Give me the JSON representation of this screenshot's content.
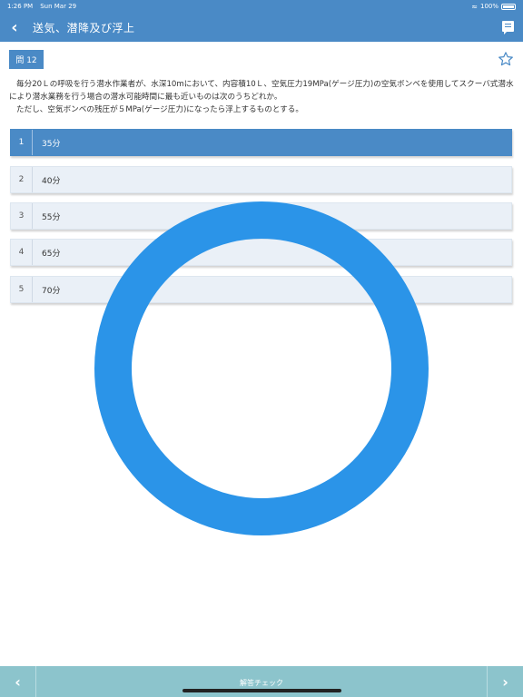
{
  "status": {
    "time": "1:26 PM",
    "date": "Sun Mar 29",
    "battery": "100%",
    "wifi_icon": "wifi-icon",
    "battery_icon": "battery-icon"
  },
  "header": {
    "title": "送気、潜降及び浮上",
    "back_icon": "chevron-left-icon",
    "comment_icon": "comment-icon",
    "color": "#4a8ac6"
  },
  "question": {
    "number": "問 12",
    "lines": [
      "毎分20Ｌの呼吸を行う潜水作業者が、水深10mにおいて、内容積10Ｌ、空気圧力19MPa(ゲージ圧力)の空気ボンベを使用してスクーバ式潜水により潜水業務を行う場合の潜水可能時間に最も近いものは次のうちどれか。",
      "ただし、空気ボンベの残圧が５MPa(ゲージ圧力)になったら浮上するものとする。"
    ]
  },
  "options": [
    {
      "num": "1",
      "label": "35分",
      "selected": true
    },
    {
      "num": "2",
      "label": "40分",
      "selected": false
    },
    {
      "num": "3",
      "label": "55分",
      "selected": false
    },
    {
      "num": "4",
      "label": "65分",
      "selected": false
    },
    {
      "num": "5",
      "label": "70分",
      "selected": false
    }
  ],
  "loading_color": "#2b94e8",
  "footer": {
    "check_label": "解答チェック",
    "prev_icon": "chevron-left-icon",
    "next_icon": "chevron-right-icon"
  }
}
